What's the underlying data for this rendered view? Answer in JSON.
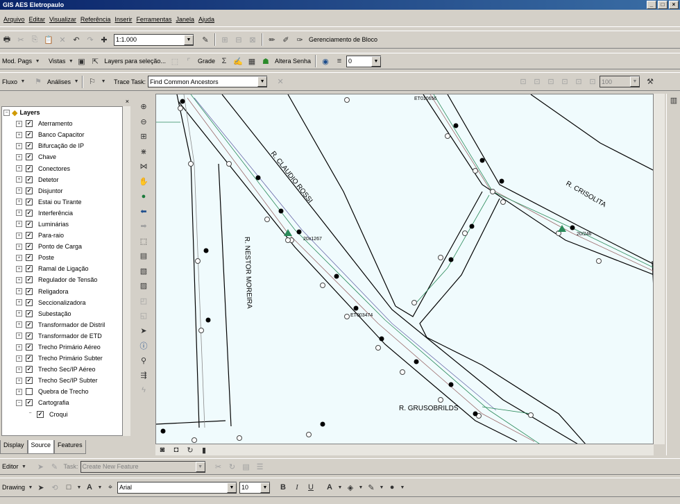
{
  "window": {
    "title": "GIS AES Eletropaulo"
  },
  "menu": [
    "Arquivo",
    "Editar",
    "Visualizar",
    "Referência",
    "Inserir",
    "Ferramentas",
    "Janela",
    "Ajuda"
  ],
  "toolbar1": {
    "scale": "1:1.000",
    "block_manager": "Gerenciamento de Bloco"
  },
  "toolbar2": {
    "mod_pags": "Mod. Pags",
    "vistas": "Vistas",
    "layers_sel": "Layers para seleção...",
    "grade": "Grade",
    "altera_senha": "Altera Senha",
    "zero_value": "0"
  },
  "toolbar3": {
    "fluxo": "Fluxo",
    "analises": "Análises",
    "trace_task_label": "Trace Task:",
    "trace_task_value": "Find Common Ancestors",
    "zoom_value": "100"
  },
  "toc": {
    "root": "Layers",
    "layers": [
      "Aterramento",
      "Banco Capacitor",
      "Bifurcação de IP",
      "Chave",
      "Conectores",
      "Detetor",
      "Disjuntor",
      "Estai ou Tirante",
      "Interferência",
      "Luminárias",
      "Para-raio",
      "Ponto de Carga",
      "Poste",
      "Ramal de Ligação",
      "Regulador de Tensão",
      "Religadora",
      "Seccionalizadora",
      "Subestação",
      "Transformador de Distril",
      "Transformador de ETD",
      "Trecho Primário Aéreo",
      "Trecho Primário Subter",
      "Trecho Sec/IP Aéreo",
      "Trecho Sec/IP Subter",
      "Quebra de Trecho",
      "Cartografia",
      "Croqui"
    ],
    "unchecked_layer": "Quebra de Trecho",
    "tabs": [
      "Display",
      "Source",
      "Features"
    ]
  },
  "map": {
    "street_labels": [
      "R. CLAUDIO ROSSI",
      "R. CRISOLITA",
      "R. NESTOR MOREIRA",
      "R. GRUSOBRILDS"
    ],
    "feature_labels": [
      "ET010656",
      "20x1267",
      "20/246",
      "ET003474"
    ]
  },
  "editor": {
    "editor_label": "Editor",
    "task_label": "Task:",
    "task_value": "Create New Feature",
    "target_label": "Target:"
  },
  "drawing": {
    "label": "Drawing",
    "font": "Arial",
    "size": "10",
    "bold": "B",
    "italic": "I",
    "underline": "U"
  }
}
